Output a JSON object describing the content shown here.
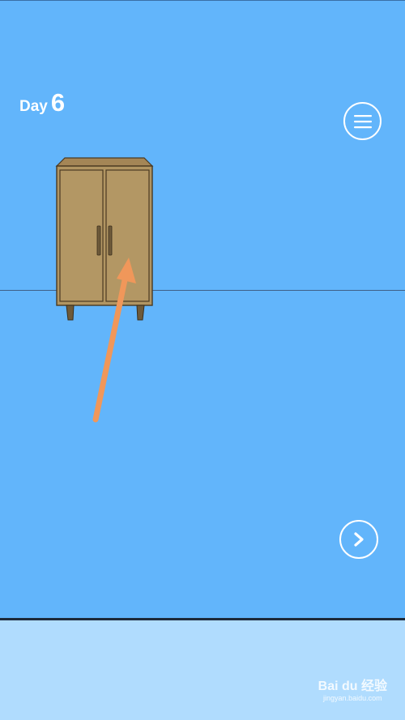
{
  "scene": {
    "day_word": "Day",
    "day_number": "6"
  },
  "buttons": {
    "menu_icon": "hamburger-menu-icon",
    "next_icon": "chevron-right-icon"
  },
  "objects": {
    "cabinet": "wardrobe",
    "annotation": "orange-arrow"
  },
  "watermark": {
    "brand": "Bai du 经验",
    "site": "jingyan.baidu.com"
  },
  "colors": {
    "sky": "#62b5fb",
    "panel": "#b0dcfe",
    "cabinet": "#b19562",
    "arrow": "#f0975a"
  }
}
